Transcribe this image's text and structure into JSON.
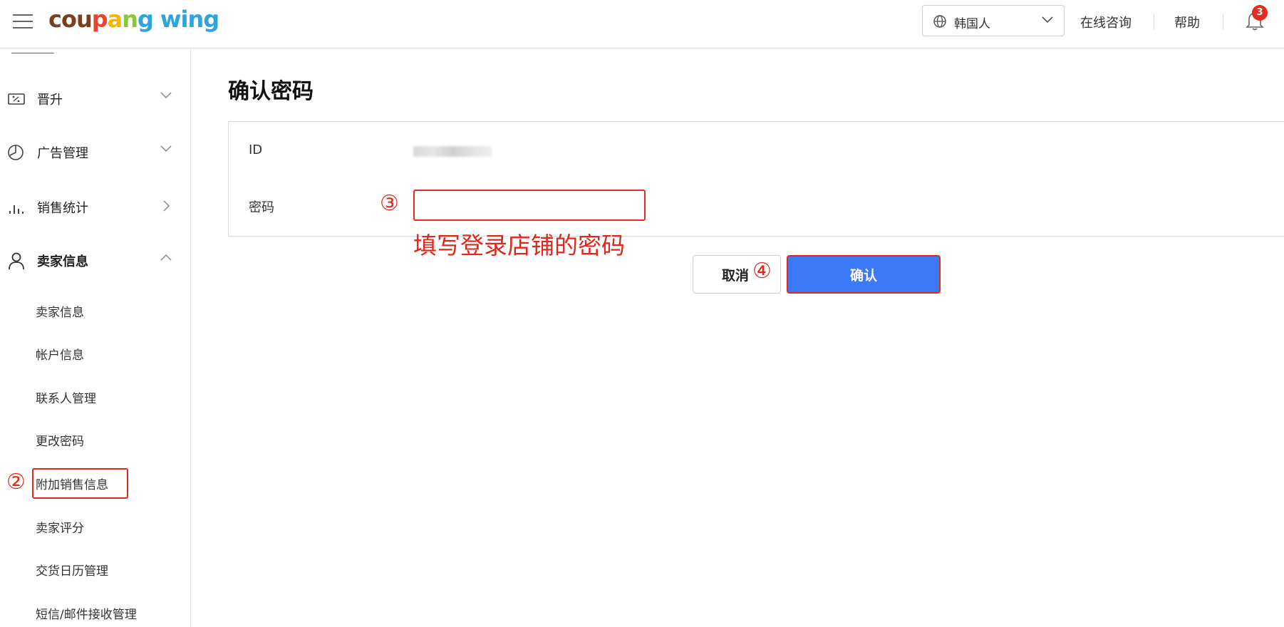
{
  "header": {
    "logo": {
      "c1": "cou",
      "c2": "p",
      "c3": "a",
      "c4": "n",
      "c5": "g",
      "wing": "wing"
    },
    "language": "韩国人",
    "online_consult": "在线咨询",
    "help": "帮助",
    "notification_count": "3"
  },
  "sidebar": {
    "menu": [
      {
        "label": "晋升",
        "icon": "ticket-icon",
        "chevron": "down"
      },
      {
        "label": "广告管理",
        "icon": "pie-clock-icon",
        "chevron": "down"
      },
      {
        "label": "销售统计",
        "icon": "bar-chart-icon",
        "chevron": "right"
      },
      {
        "label": "卖家信息",
        "icon": "user-icon",
        "chevron": "up"
      }
    ],
    "sub_items": [
      "卖家信息",
      "帐户信息",
      "联系人管理",
      "更改密码",
      "附加销售信息",
      "卖家评分",
      "交货日历管理",
      "短信/邮件接收管理"
    ]
  },
  "main": {
    "title": "确认密码",
    "id_label": "ID",
    "password_label": "密码",
    "password_value": "",
    "cancel_label": "取消",
    "confirm_label": "确认"
  },
  "annotations": {
    "step2": "②",
    "step3": "③",
    "step4": "④",
    "hint": "填写登录店铺的密码"
  },
  "colors": {
    "accent": "#3b79f6",
    "annotation": "#e0271c",
    "badge": "#e52a1f"
  }
}
